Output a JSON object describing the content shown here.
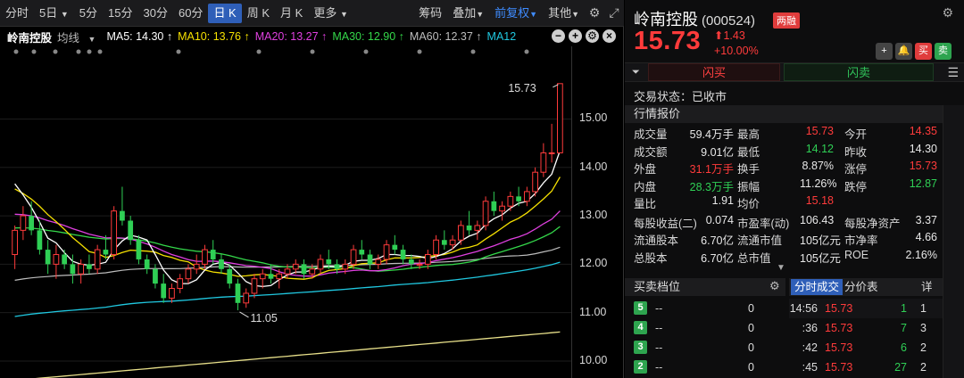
{
  "toolbar": {
    "periods": [
      "分时",
      "5日",
      "5分",
      "15分",
      "30分",
      "60分",
      "日 K",
      "周 K",
      "月 K",
      "更多"
    ],
    "active_period": "日 K",
    "tools": [
      "筹码",
      "叠加",
      "前复权",
      "其他"
    ]
  },
  "stock_short": "岭南控股",
  "ma_legend": {
    "mode": "均线",
    "ma5": "MA5: 14.30 ↑",
    "ma10": "MA10: 13.76 ↑",
    "ma20": "MA20: 13.27 ↑",
    "ma30": "MA30: 12.90 ↑",
    "ma60": "MA60: 12.37 ↑",
    "ma12": "MA12"
  },
  "colors": {
    "up": "#ff3b3b",
    "down": "#2fcf55",
    "ma5": "#ffffff",
    "ma10": "#f5e000",
    "ma20": "#e040e0",
    "ma30": "#34d84a",
    "ma60": "#bdbdbd",
    "ma12": "#20c8e0",
    "ma_long": "#e8e08a"
  },
  "chart_data": {
    "type": "candlestick",
    "high_label": "15.73",
    "low_label": "11.05",
    "yticks": [
      "15.00",
      "14.00",
      "13.00",
      "12.00",
      "11.00",
      "10.00"
    ],
    "ylim": [
      9.65,
      16.5
    ],
    "candles": [
      [
        12.2,
        12.8,
        11.9,
        12.7
      ],
      [
        12.7,
        13.2,
        12.5,
        13.0
      ],
      [
        13.0,
        13.3,
        12.6,
        12.7
      ],
      [
        12.7,
        12.9,
        12.2,
        12.3
      ],
      [
        12.3,
        12.5,
        11.8,
        12.0
      ],
      [
        12.0,
        12.4,
        11.7,
        12.2
      ],
      [
        12.2,
        12.3,
        11.9,
        12.0
      ],
      [
        12.0,
        12.2,
        11.6,
        11.8
      ],
      [
        11.8,
        12.1,
        11.6,
        12.0
      ],
      [
        12.0,
        12.2,
        11.8,
        11.9
      ],
      [
        11.9,
        12.4,
        11.8,
        12.3
      ],
      [
        12.3,
        12.6,
        12.1,
        12.2
      ],
      [
        12.2,
        13.2,
        12.1,
        13.1
      ],
      [
        13.1,
        13.6,
        12.8,
        12.9
      ],
      [
        12.9,
        13.0,
        12.4,
        12.5
      ],
      [
        12.5,
        12.6,
        12.0,
        12.1
      ],
      [
        12.1,
        12.2,
        11.8,
        11.9
      ],
      [
        11.9,
        12.0,
        11.5,
        11.6
      ],
      [
        11.6,
        11.8,
        11.2,
        11.3
      ],
      [
        11.3,
        11.6,
        11.2,
        11.5
      ],
      [
        11.5,
        11.8,
        11.4,
        11.7
      ],
      [
        11.7,
        12.0,
        11.6,
        11.9
      ],
      [
        11.9,
        12.2,
        11.8,
        12.0
      ],
      [
        12.0,
        12.4,
        11.9,
        12.3
      ],
      [
        12.3,
        12.5,
        12.0,
        12.1
      ],
      [
        12.1,
        12.2,
        11.8,
        11.9
      ],
      [
        11.9,
        12.0,
        11.5,
        11.6
      ],
      [
        11.6,
        11.7,
        11.05,
        11.2
      ],
      [
        11.2,
        11.5,
        11.1,
        11.4
      ],
      [
        11.4,
        11.8,
        11.3,
        11.7
      ],
      [
        11.7,
        11.9,
        11.5,
        11.8
      ],
      [
        11.8,
        12.0,
        11.6,
        11.7
      ],
      [
        11.7,
        11.9,
        11.5,
        11.8
      ],
      [
        11.8,
        12.0,
        11.7,
        11.9
      ],
      [
        11.9,
        12.1,
        11.8,
        12.0
      ],
      [
        12.0,
        12.1,
        11.7,
        11.8
      ],
      [
        11.8,
        12.0,
        11.7,
        11.9
      ],
      [
        11.9,
        12.2,
        11.8,
        12.1
      ],
      [
        12.1,
        12.3,
        11.9,
        12.0
      ],
      [
        12.0,
        12.1,
        11.8,
        11.9
      ],
      [
        11.9,
        12.1,
        11.8,
        12.0
      ],
      [
        12.0,
        12.4,
        11.9,
        12.3
      ],
      [
        12.3,
        12.5,
        12.1,
        12.2
      ],
      [
        12.2,
        12.3,
        11.9,
        12.0
      ],
      [
        12.0,
        12.2,
        11.9,
        12.1
      ],
      [
        12.1,
        12.5,
        12.0,
        12.4
      ],
      [
        12.4,
        12.6,
        12.2,
        12.3
      ],
      [
        12.3,
        12.4,
        12.0,
        12.1
      ],
      [
        12.1,
        12.2,
        11.9,
        12.0
      ],
      [
        12.0,
        12.1,
        11.9,
        12.0
      ],
      [
        12.0,
        12.3,
        11.9,
        12.2
      ],
      [
        12.2,
        12.6,
        12.1,
        12.5
      ],
      [
        12.5,
        12.7,
        12.3,
        12.4
      ],
      [
        12.4,
        12.6,
        12.3,
        12.5
      ],
      [
        12.5,
        12.9,
        12.4,
        12.8
      ],
      [
        12.8,
        13.1,
        12.6,
        12.7
      ],
      [
        12.7,
        12.9,
        12.5,
        12.8
      ],
      [
        12.8,
        13.4,
        12.7,
        13.3
      ],
      [
        13.3,
        13.5,
        13.0,
        13.1
      ],
      [
        13.1,
        13.3,
        12.9,
        13.2
      ],
      [
        13.2,
        13.5,
        13.1,
        13.4
      ],
      [
        13.4,
        13.6,
        13.2,
        13.3
      ],
      [
        13.3,
        13.6,
        13.2,
        13.5
      ],
      [
        13.5,
        14.0,
        13.4,
        13.9
      ],
      [
        13.9,
        14.5,
        13.8,
        14.3
      ],
      [
        14.3,
        14.9,
        14.1,
        14.3
      ],
      [
        14.3,
        15.73,
        14.3,
        15.73
      ]
    ]
  },
  "quote": {
    "name": "岭南控股",
    "code": "(000524)",
    "badge": "两融",
    "price": "15.73",
    "change": "1.43",
    "change_pct": "+10.00%",
    "flash_buy": "闪买",
    "flash_sell": "闪卖",
    "trade_state": "交易状态：已收市",
    "section_title": "行情报价",
    "rows": [
      [
        "成交量",
        "59.4万手",
        "最高",
        "15.73",
        "今开",
        "14.35"
      ],
      [
        "成交额",
        "9.01亿",
        "最低",
        "14.12",
        "昨收",
        "14.30"
      ],
      [
        "外盘",
        "31.1万手",
        "换手",
        "8.87%",
        "涨停",
        "15.73"
      ],
      [
        "内盘",
        "28.3万手",
        "振幅",
        "11.26%",
        "跌停",
        "12.87"
      ],
      [
        "量比",
        "1.91",
        "均价",
        "15.18",
        "",
        ""
      ],
      [
        "每股收益(二)",
        "0.074",
        "市盈率(动)",
        "106.43",
        "每股净资产",
        "3.37"
      ],
      [
        "流通股本",
        "6.70亿",
        "流通市值",
        "105亿元",
        "市净率",
        "4.66"
      ],
      [
        "总股本",
        "6.70亿",
        "总市值",
        "105亿元",
        "ROE",
        "2.16%"
      ]
    ],
    "orderbook_title": "买卖档位",
    "orderbook": [
      [
        "5",
        "--",
        "0"
      ],
      [
        "4",
        "--",
        "0"
      ],
      [
        "3",
        "--",
        "0"
      ],
      [
        "2",
        "--",
        "0"
      ]
    ],
    "tick_tabs": [
      "分时成交",
      "分价表",
      "详"
    ],
    "ticks": [
      [
        "14:56",
        "15.73",
        "1",
        "1"
      ],
      [
        ":36",
        "15.73",
        "7",
        "3"
      ],
      [
        ":42",
        "15.73",
        "6",
        "2"
      ],
      [
        ":45",
        "15.73",
        "27",
        "2"
      ]
    ]
  }
}
